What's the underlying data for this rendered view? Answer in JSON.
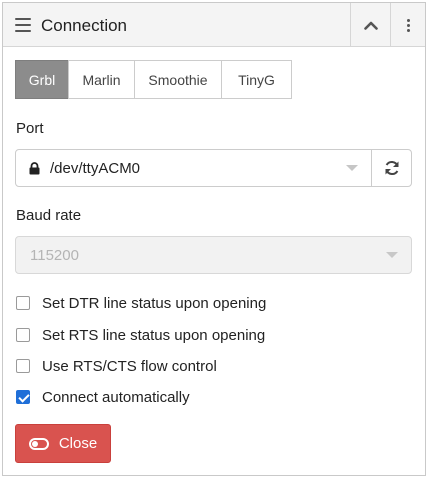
{
  "header": {
    "title": "Connection",
    "menu_icon": "hamburger-icon",
    "collapse_icon": "chevron-up-icon",
    "more_icon": "vertical-ellipsis-icon"
  },
  "tabs": [
    {
      "label": "Grbl",
      "active": true
    },
    {
      "label": "Marlin",
      "active": false
    },
    {
      "label": "Smoothie",
      "active": false
    },
    {
      "label": "TinyG",
      "active": false
    }
  ],
  "port": {
    "label": "Port",
    "value": "/dev/ttyACM0",
    "lock_icon": "lock-icon",
    "refresh_icon": "refresh-icon"
  },
  "baud": {
    "label": "Baud rate",
    "value": "115200",
    "disabled": true
  },
  "options": [
    {
      "label": "Set DTR line status upon opening",
      "checked": false
    },
    {
      "label": "Set RTS line status upon opening",
      "checked": false
    },
    {
      "label": "Use RTS/CTS flow control",
      "checked": false
    },
    {
      "label": "Connect automatically",
      "checked": true
    }
  ],
  "close_button": {
    "label": "Close",
    "icon": "toggle-on-icon",
    "color": "#d9534f"
  },
  "colors": {
    "active_tab": "#8c8c8c",
    "checkbox_checked": "#1f6fd8"
  }
}
